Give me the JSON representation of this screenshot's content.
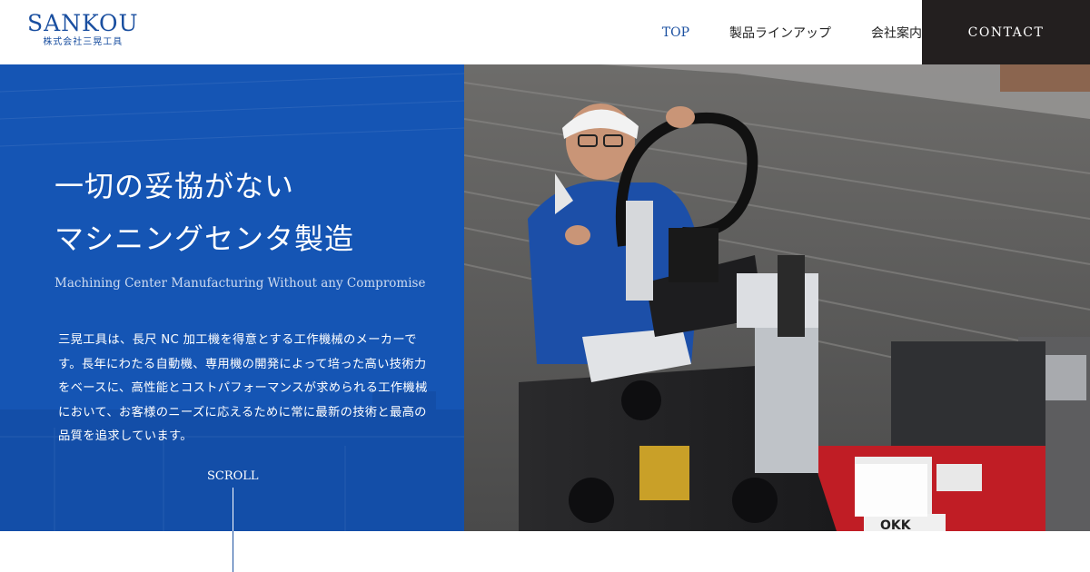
{
  "header": {
    "logo_main": "SANKOU",
    "logo_sub": "株式会社三晃工具",
    "nav": [
      {
        "label": "TOP",
        "active": true
      },
      {
        "label": "製品ラインアップ",
        "active": false
      },
      {
        "label": "会社案内",
        "active": false
      }
    ],
    "contact_label": "CONTACT"
  },
  "hero": {
    "headline_1": "一切の妥協がない",
    "headline_2": "マシニングセンタ製造",
    "tagline": "Machining Center Manufacturing Without any Compromise",
    "description": "三晃工具は、長尺 NC 加工機を得意とする工作機械のメーカーです。長年にわたる自動機、専用機の開発によって培った高い技術力をベースに、高性能とコストパフォーマンスが求められる工作機械において、お客様のニーズに応えるために常に最新の技術と最高の品質を追求しています。",
    "scroll_label": "SCROLL",
    "photo_calendar_label": "OKK"
  },
  "colors": {
    "brand_blue": "#1a4fa0",
    "hero_blue": "#1555b4",
    "contact_bg": "#231f1f"
  }
}
